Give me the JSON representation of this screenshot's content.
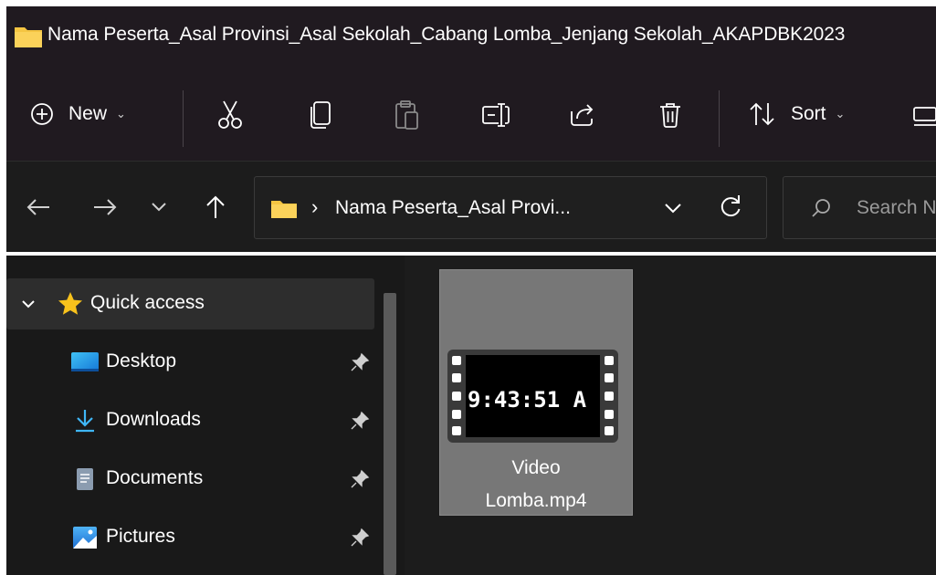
{
  "window": {
    "title": "Nama Peserta_Asal Provinsi_Asal Sekolah_Cabang Lomba_Jenjang Sekolah_AKAPDBK2023",
    "title_icon": "folder-icon"
  },
  "toolbar": {
    "new_label": "New",
    "sort_label": "Sort",
    "icons": [
      "plus-circle-icon",
      "cut-icon",
      "copy-icon",
      "paste-icon",
      "rename-icon",
      "share-icon",
      "delete-icon",
      "sort-icon",
      "view-icon"
    ]
  },
  "address": {
    "path_text": "Nama Peserta_Asal Provi...",
    "separator": "›"
  },
  "search": {
    "placeholder": "Search N"
  },
  "sidebar": {
    "quick_access_label": "Quick access",
    "items": [
      {
        "label": "Desktop",
        "icon": "desktop-icon"
      },
      {
        "label": "Downloads",
        "icon": "download-icon"
      },
      {
        "label": "Documents",
        "icon": "document-icon"
      },
      {
        "label": "Pictures",
        "icon": "pictures-icon"
      }
    ]
  },
  "content": {
    "files": [
      {
        "name_line1": "Video",
        "name_line2": "Lomba.mp4",
        "thumbnail_text": "9:43:51 A",
        "icon": "video-file-icon"
      }
    ]
  },
  "colors": {
    "background": "#1c1c1c",
    "titlebar": "#201a20",
    "selection": "#777777",
    "folder": "#f5c542"
  }
}
